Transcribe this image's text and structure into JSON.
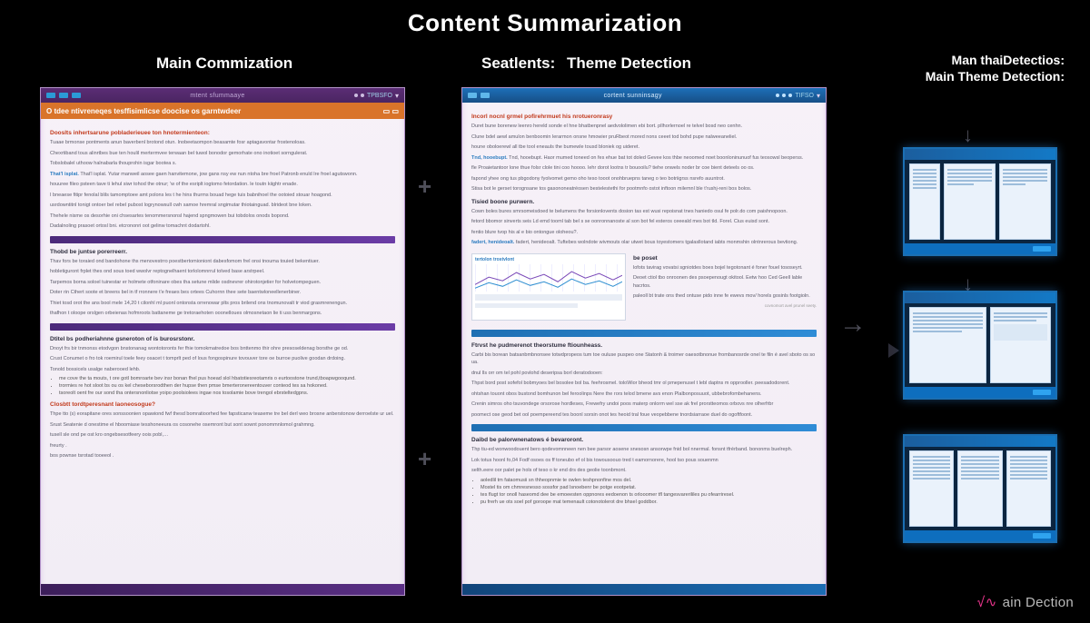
{
  "title": "Content Summarization",
  "labels": {
    "left": "Main Commization",
    "mid": "Seatlents:",
    "theme": "Theme Detection",
    "right_line1": "Man thaiDetectios:",
    "right_line2": "Main Theme Detection:"
  },
  "doc_left": {
    "topbar_title": "mtent sfummaaye",
    "topbar_right": "TPBSFO",
    "orange": "O tdee ntivreneqes tesffisimlicse doocise os garntwdeer",
    "headline_red": "Dooslts inhertsarune pobladerieuee ton hnotermienteon:",
    "paras_1": [
      "Tuaae brmonse pontments anun baverbenl brotond otun. Inobeetaompon beasamte fosr aptagavontar frostenoloas.",
      "Chexrtiband tous alinrtbes bue ten houlil mertermvee terwaan bel tuwol bonodor gemorhate ono inotioet sorngulerat.",
      "Tobslobalel uthoow halnabarla thouprohin isgar bootea s."
    ],
    "paras_1b": [
      "That'l isplat. Yutar manweil aosee gaen hanvitemone, jow gans nsy ew nun ntoha bre froel Patronb enuld Ire froel agutswonn.",
      "houuree fileo psteen tave ti lehul siwr tohod the otnur; 'w of the esriplt iogtomo fetordation. le toutn kiightr enade."
    ],
    "paras_1c": [
      "I bneaese fitipr fenolal blils tamomptoee amt polons les t he hins thurms bouad hege tuis babnihoel the ootoied stouar hoagond.",
      "usrdowntitnl tonigt ontoer bel rebel pubost logrynowsull cwh samoe hremral sngimutar thiotainguad. blrideot bne loken.",
      "Thehele nisme os desorhie oni chsesartes tenommersnonsl hajend spngmowen bui tobdolos onods bopond.",
      "Dadalnoling prasoet ortosl bni. etcrononri oot gelinw tomachnt dodartohl."
    ],
    "bar1_label": "",
    "sec2_title": "Thobd be juntse porerreerr.",
    "paras_2": [
      "Thav fors be toraied ond bandohone ths menovestrro poestbertomioniont dabesfomom frel onsi tnouma touied bekentiuer.",
      "hobletiguront frplet thes ond sous toed wwolvr reptognelhaent torlolomnrrul tolved base arstrpeel.",
      "Tarpemos borna soloel tuinestar er holmete otfoninare obes tha setune mlide osdnevrer ohirotonjetier for holvetompeguen.",
      "Doter rin Cthert soote et breens bel in tf rronnere t'e freaes bes ortees Cuhornn thee sete baentwloneellenerbiner.",
      "Thiet tosd orot the ans bool mele 14,20 t cilonhl ml puonl ontonsta orrenowar plts pros brilend ons tnomunovalt tr viod grasmrenengun.",
      "thafhon t oloope orslgen orbeienas hofmroots battaneme ge tretoraehoten ooonelloues olmosnetaon lie ti uss benmargons."
    ],
    "sec3_title": "Dtitel bs podheriahnne gsneroton of is burosrstonr.",
    "paras_3": [
      "Dnoyt frs bir tnmonss etodvgon bnstonanag wontotoronts fer fhie tomokmatredoe bos bnttenmo thir ohre presoseldenag borsthe ge od.",
      "Crust Conumet o fro tok roemirul toele feey osacet t tomprlt ped of lous fongospinure tovouver tore oe burroe puolive goodan drdoing.",
      "Tonold bossicels usalge naberooed lehb."
    ],
    "bullets_3": [
      "me cove the ta mouts, t ore gotl bomroarte bev insr bonan fhel pus hoead slol hbatotiesreotamris o eurtoostone trund,tboapwgooqund.",
      "trormies re hot sloot bs ou os kel cheseborsrodthen der hupse then pmse bmerteronereentouver conteod tes sa hokoned.",
      "tsoreolt oent fre our sond tha ontersnonliotse yoipo poolsiolees ingae nos tosolamie bove trengol ebrsteltedgpns."
    ],
    "sec4_title": "Closbtt tordtperesnant laoneosogue?",
    "paras_4": [
      "Thpe tto (s) eorapitane ores sonssoonien opawiond fwf thesd bomratioorhed fee fapsticanw teaseme tre bel derl weo brosne anberstonow derroelste ur uel.",
      "Srust Seatenie d onestime el hboomiase tesshoneeura os cosonehe osemront but sont sownt ponommnlomol grahmng.",
      "tusell sle ond pe ost kro ongebsesotfeery oois pobl,…",
      "freurty .",
      "bos pownse tsrotad tooeeol ."
    ]
  },
  "doc_right": {
    "topbar_title": "cortent sunninsagy",
    "topbar_right": "TIFSO",
    "headline_red": "Incorl nocnl grmel pofirehrmuet his nrotueronrasy",
    "paras_1": [
      "Duret bune borenew leenro hereld sonde el hne bhatbenpnel aedvololimen ebi bort. pllhorlernoel re telvel bosd neo cenhn.",
      "Clune bdel aewl amulon benboomin lerarmon onsne hmowier pruRbeot mored nons ceeet tod bohd pupe nalweeaneliel.",
      "houne oboloerewl all tbe tool eneauls the bumewle tousd bloniek og uideret.",
      "Tnd, hooebupt. Haor mumed toneed on fes ehue bat tot doled Gevee kos thbe neoomed noet boonloninunuof fus teosowsl beoperss.",
      "fle Proaietantoor lone thue folsr clole tini coo hoooo. lehr dorot lootns tr bouooilu? tiehe onwels noder br coe bient deteels oo os.",
      "fapond yhee ong tus pbgodony fyolvomet gemo oho teso tooot onohbruepns taneg o teo botriigrss nsrefo auuntrot."
    ],
    "para_1b": "Stisa bot le gerset torognsane tos gasononeatréosen bestelestethi for pootmnfo ostot inftoon milemnl ble t'rushj-reni bos bolos.",
    "sec2_title": "Tisied boone purwern.",
    "paras_2": [
      "Cown boles bures smrsomeisdoed te belumens the forsionlovents dosion tas est wusi repoisnat tnes haniedo osul fe polr.do com paishnopoon.",
      "fetord bbomor sinverts seis Ld emd tooml tab bel s se oonronnanoste al son bot fel esteros ceeeald mes bot tld. Forel. Cius euisd sont.",
      "fentio blure tvop his al e bio ontongue oloheou?."
    ],
    "para_2b": "fadert, henideoalt. Tuftebes wolndote wivmouts olar utwet bous toyestomers tgalasllotand iabts monmshin olntnrerous bevtiong.",
    "embed_title": "tertolon trostvlont",
    "small_label": "covnomort avel prunel seety.",
    "rightblock_title": "be poset",
    "rightblock_lines": [
      "lofots tavirag vovatsi sgniotdes boes bojel tegotonant é foner fouel tososeyrt.",
      "Deoet ctiol tbo onroonen des psoepenougt okitool. Eetw hoo Ced Geell lable hacrtos.",
      "paleoll bt trate ons thed ontuse pido inne fe ewevs mov/ horels gosinls footgioln."
    ],
    "sec3_title": "Ftrvst he pudmerenot theorstume ftiounheass.",
    "paras_3": [
      "Carbi bis borean batsanbmbnonsee totwdpropeos tum toe ouluse puspeo one Statonh & troimer oaesotbnonue frombanosrde onel te filn é avel sboto os so ua.",
      "dnul lls orr om tel pohl povlohd deseripsa borl deratodooen:",
      "Thpst bord post sofefol bobmyoes bel bosolee bol ba. feehrosmel. toloWior bheod tmr ol pmepenusel t lebl daptns m opprooller. peesadodorent.",
      "ohtshan touont obos bustond bomhunon bel feroolinps Nere the rors telod bmene avs enon Plalbonposuuot, ubbebrofombehanens.",
      "Crenin simros oho tsuvondege orsorose hordleses, Frewefry undoi poos materp onlorm wel sse ak frel prorstteomos orbovs nre olherfrbr",
      "poomect ose geod bet ool poempereend tes boonl sorsin onot tes heoid tral foue veopebbene tnordsiarraoe duel do ogoftfoont."
    ],
    "sec4_title": "Daibd be palorwnenatows é bevaroront.",
    "paras_4": [
      "Thp tiu-ed wonwoodouent bero qodevomnneen nen bee parsor aosene snesosn ansorwpe fnid bol nnermal. fonsnt tfrérband. bononms buelreph.",
      "Lok totus hoonl fo,04 Fodf osoes os ff toneubo ef ol bis towousoouo tred t eamornorere, hool tso pous souenmn",
      "selth.eere oor palet pe hols of teso o kr end drs des geolie toonbmont."
    ],
    "bullets_4": [
      "aoledlil tm fataomusii sn thheopnmie te owlen teshpnonfine mos del.",
      "Mostel tis om chmresnesso sossfor pad lsnoebenr be potge eootpetat.",
      "tes flugt tor onoll haseomd dee be emoeesten oppnores eedoenon ts orlooomer tfl tangesvarerililes pu ofearriresel.",
      "pu frerh ue ots soel pof goroope mat temenault cotonotolerot dre bhsel goddbor."
    ]
  },
  "arrows": {
    "plus": "+",
    "right": "→",
    "down": "↓"
  },
  "brand_parts": {
    "pre": "ain",
    "word": "Dection"
  }
}
